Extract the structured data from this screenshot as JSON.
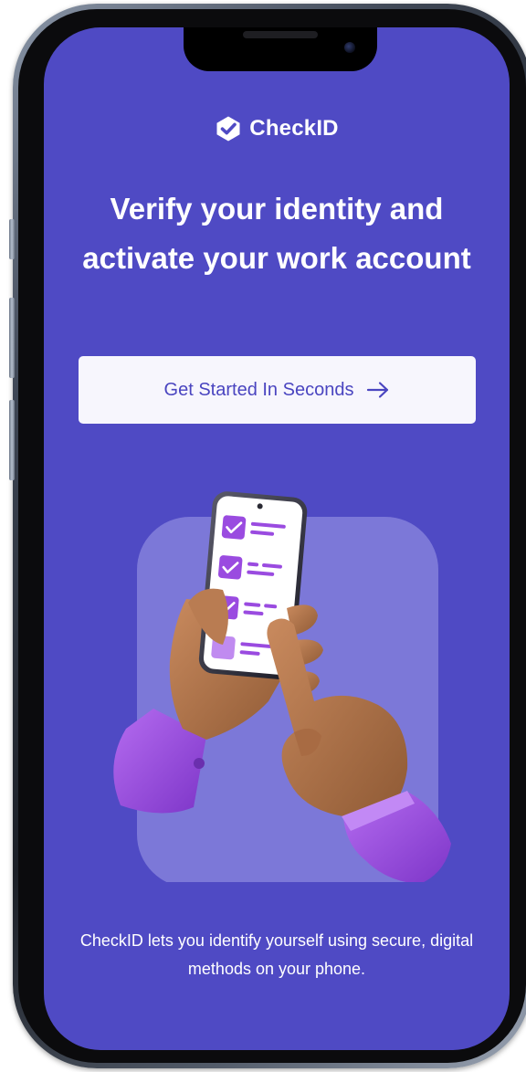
{
  "app": {
    "brand_name": "CheckID",
    "brand_icon": "shield-check-icon"
  },
  "onboarding": {
    "headline": "Verify your identity and activate your work account",
    "cta_label": "Get Started In Seconds",
    "cta_icon": "arrow-right-icon",
    "description": "CheckID lets you identify yourself using secure, digital methods on your phone.",
    "illustration": "hand-holding-phone-checklist-illustration",
    "checklist": {
      "checked_items": 3,
      "total_items": 4
    }
  },
  "colors": {
    "screen_background": "#4f4ac4",
    "button_background": "#f7f6fd",
    "button_text": "#4a45c0",
    "accent_purple": "#9a4be0",
    "text_light": "#ffffff"
  }
}
